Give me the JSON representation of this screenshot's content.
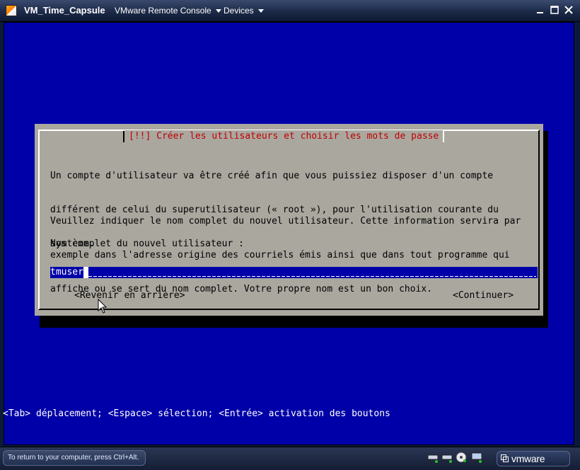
{
  "window": {
    "title": "VM_Time_Capsule",
    "menus": [
      {
        "label": "VMware Remote Console"
      },
      {
        "label": "Devices"
      }
    ],
    "controls": [
      "minimize-icon",
      "maximize-icon",
      "close-icon"
    ]
  },
  "dialog": {
    "title": "[!!] Créer les utilisateurs et choisir les mots de passe",
    "paragraph1": [
      "Un compte d'utilisateur va être créé afin que vous puissiez disposer d'un compte",
      "différent de celui du superutilisateur (« root »), pour l'utilisation courante du",
      "système."
    ],
    "paragraph2": [
      "Veuillez indiquer le nom complet du nouvel utilisateur. Cette information servira par",
      "exemple dans l'adresse origine des courriels émis ainsi que dans tout programme qui",
      "affiche ou se sert du nom complet. Votre propre nom est un bon choix."
    ],
    "field_label": "Nom complet du nouvel utilisateur :",
    "field_value": "tmuser",
    "back_button": "<Revenir en arrière>",
    "continue_button": "<Continuer>"
  },
  "help_line": "<Tab> déplacement; <Espace> sélection; <Entrée> activation des boutons",
  "status": {
    "hint": "To return to your computer, press Ctrl+Alt.",
    "device_icons": [
      "network-adapter-icon",
      "network-adapter-icon",
      "cd-rom-icon",
      "display-icon"
    ],
    "brand": "vmware"
  },
  "colors": {
    "console_bg": "#0000a8",
    "dialog_bg": "#aaa79f",
    "dialog_title": "#c00000",
    "title_bar": "#1c2a48"
  }
}
